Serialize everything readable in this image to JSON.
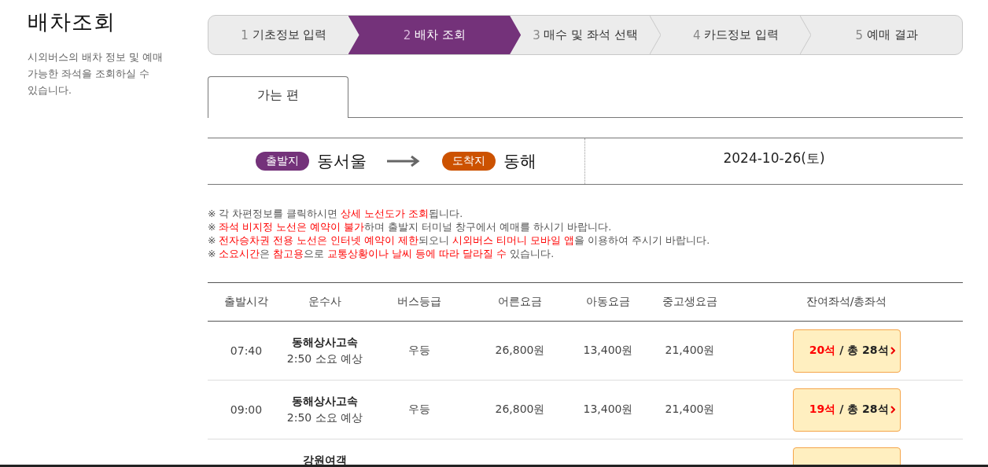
{
  "sidebar": {
    "title": "배차조회",
    "description": "시외버스의 배차 정보 및 예매 가능한 좌석을 조회하실 수 있습니다."
  },
  "steps": [
    {
      "number": "1",
      "label": "기초정보 입력",
      "selected": false
    },
    {
      "number": "2",
      "label": "배차 조회",
      "selected": true
    },
    {
      "number": "3",
      "label": "매수 및 좌석 선택",
      "selected": false
    },
    {
      "number": "4",
      "label": "카드정보 입력",
      "selected": false
    },
    {
      "number": "5",
      "label": "예매 결과",
      "selected": false
    }
  ],
  "tabs": [
    {
      "label": "가는 편",
      "selected": true
    }
  ],
  "route": {
    "departure_badge": "출발지",
    "departure": "동서울",
    "arrival_badge": "도착지",
    "arrival": "동해",
    "date": "2024-10-26(토)"
  },
  "notes": [
    [
      {
        "text": "※ 각 차편정보를 클릭하시면 ",
        "highlight": false
      },
      {
        "text": "상세 노선도가 조회",
        "highlight": true
      },
      {
        "text": "됩니다.",
        "highlight": false
      }
    ],
    [
      {
        "text": "※ ",
        "highlight": false
      },
      {
        "text": "좌석 비지정 노선은 예약이 불가",
        "highlight": true
      },
      {
        "text": "하며 출발지 터미널 창구에서 예매를 하시기 바랍니다.",
        "highlight": false
      }
    ],
    [
      {
        "text": "※ ",
        "highlight": false
      },
      {
        "text": "전자승차권 전용 노선은 인터넷 예약이 제한",
        "highlight": true
      },
      {
        "text": "되오니 ",
        "highlight": false
      },
      {
        "text": "시외버스 티머니 모바일 앱",
        "highlight": true
      },
      {
        "text": "을 이용하여 주시기 바랍니다.",
        "highlight": false
      }
    ],
    [
      {
        "text": "※ ",
        "highlight": false
      },
      {
        "text": "소요시간",
        "highlight": true
      },
      {
        "text": "은 ",
        "highlight": false
      },
      {
        "text": "참고용",
        "highlight": true
      },
      {
        "text": "으로 ",
        "highlight": false
      },
      {
        "text": "교통상황이나 날씨 등에 따라 달라질 수",
        "highlight": true
      },
      {
        "text": " 있습니다.",
        "highlight": false
      }
    ]
  ],
  "table": {
    "columns": [
      "출발시각",
      "운수사",
      "버스등급",
      "어른요금",
      "아동요금",
      "중고생요금",
      "잔여좌석/총좌석"
    ],
    "rows": [
      {
        "time": "07:40",
        "operator": "동해상사고속",
        "duration": "2:50 소요 예상",
        "grade": "우등",
        "adult": "26,800원",
        "child": "13,400원",
        "student": "21,400원",
        "remaining": "20석",
        "total": "/ 총 28석"
      },
      {
        "time": "09:00",
        "operator": "동해상사고속",
        "duration": "2:50 소요 예상",
        "grade": "우등",
        "adult": "26,800원",
        "child": "13,400원",
        "student": "21,400원",
        "remaining": "19석",
        "total": "/ 총 28석"
      },
      {
        "operator": "강원여객"
      }
    ]
  }
}
